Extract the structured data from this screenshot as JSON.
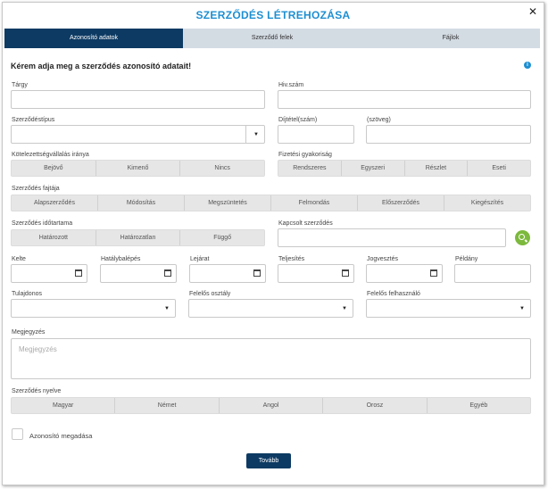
{
  "title": "SZERZŐDÉS LÉTREHOZÁSA",
  "tabs": [
    "Azonosító adatok",
    "Szerződő felek",
    "Fájlok"
  ],
  "heading": "Kérem adja meg a szerződés azonosító adatait!",
  "fields": {
    "targy": "Tárgy",
    "hivszam": "Hiv.szám",
    "szerzodestipus": "Szerződéstípus",
    "dijtetel": "Díjtétel(szám)",
    "szoveg": "(szöveg)",
    "kotelezettseg": "Kötelezettségvállalás iránya",
    "fizetesi": "Fizetési gyakoriság",
    "fajtaja": "Szerződés fajtája",
    "idotartama": "Szerződés időtartama",
    "kapcsolt": "Kapcsolt szerződés",
    "kelte": "Kelte",
    "hatalybalepes": "Hatálybalépés",
    "lejarat": "Lejárat",
    "teljesites": "Teljesítés",
    "jogvesztes": "Jogvesztés",
    "peldany": "Példány",
    "tulajdonos": "Tulajdonos",
    "felelos_osztaly": "Felelős osztály",
    "felelos_felhasznalo": "Felelős felhasználó",
    "megjegyzes": "Megjegyzés",
    "megjegyzes_placeholder": "Megjegyzés",
    "nyelve": "Szerződés nyelve",
    "azonosito_megadasa": "Azonosító megadása"
  },
  "options": {
    "kotelezettseg": [
      "Bejövő",
      "Kimenő",
      "Nincs"
    ],
    "fizetesi": [
      "Rendszeres",
      "Egyszeri",
      "Részlet",
      "Eseti"
    ],
    "fajtaja": [
      "Alapszerződés",
      "Módosítás",
      "Megszüntetés",
      "Felmondás",
      "Előszerződés",
      "Kiegészítés"
    ],
    "idotartama": [
      "Határozott",
      "Határozatlan",
      "Függő"
    ],
    "nyelve": [
      "Magyar",
      "Német",
      "Angol",
      "Orosz",
      "Egyéb"
    ]
  },
  "submit_label": "Tovább",
  "icons": {
    "close": "close-icon",
    "info": "info-icon",
    "search": "search-icon",
    "calendar": "calendar-icon",
    "dropdown": "chevron-down-icon"
  }
}
